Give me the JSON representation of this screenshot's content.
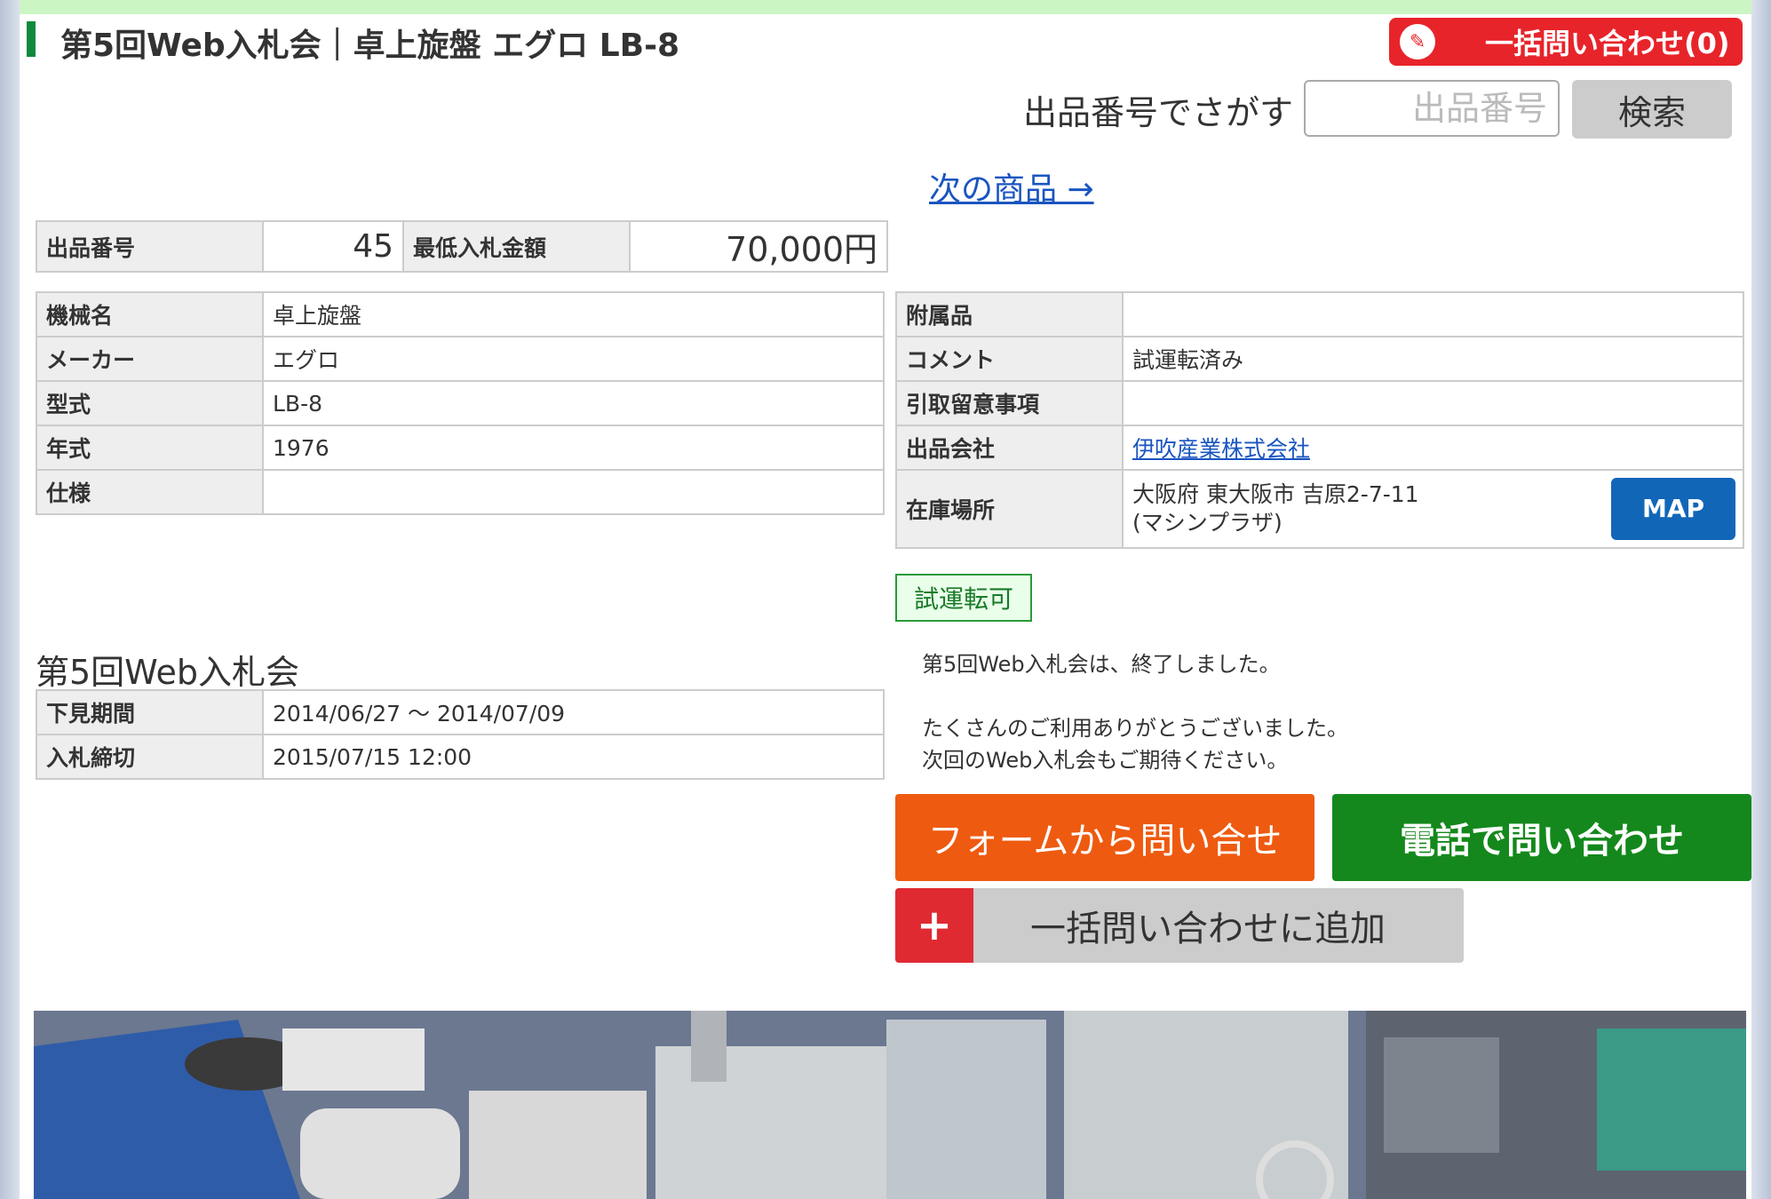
{
  "header": {
    "title": "第5回Web入札会｜卓上旋盤 エグロ LB-8",
    "bulk_inquiry_label": "一括問い合わせ(0)",
    "bulk_inquiry_icon": "clipboard-icon"
  },
  "search": {
    "label": "出品番号でさがす",
    "placeholder": "出品番号",
    "button": "検索"
  },
  "next_link": "次の商品 →",
  "summary": {
    "lot_label": "出品番号",
    "lot_value": "45",
    "min_bid_label": "最低入札金額",
    "min_bid_value": "70,000円"
  },
  "specs_left": [
    {
      "label": "機械名",
      "value": "卓上旋盤"
    },
    {
      "label": "メーカー",
      "value": "エグロ"
    },
    {
      "label": "型式",
      "value": "LB-8"
    },
    {
      "label": "年式",
      "value": "1976"
    },
    {
      "label": "仕様",
      "value": ""
    }
  ],
  "specs_right": [
    {
      "label": "附属品",
      "value": ""
    },
    {
      "label": "コメント",
      "value": "試運転済み"
    },
    {
      "label": "引取留意事項",
      "value": ""
    },
    {
      "label": "出品会社",
      "value": "伊吹産業株式会社"
    },
    {
      "label": "在庫場所",
      "value_line1": "大阪府 東大阪市 吉原2-7-11",
      "value_line2": "(マシンプラザ)",
      "map_button": "MAP"
    }
  ],
  "badge": "試運転可",
  "auction": {
    "title": "第5回Web入札会",
    "preview_label": "下見期間",
    "preview_value": "2014/06/27 〜 2014/07/09",
    "deadline_label": "入札締切",
    "deadline_value": "2015/07/15 12:00"
  },
  "notice": {
    "line1": "第5回Web入札会は、終了しました。",
    "line2": "たくさんのご利用ありがとうございました。",
    "line3": "次回のWeb入札会もご期待ください。"
  },
  "actions": {
    "form_inquiry": "フォームから問い合せ",
    "tel_inquiry": "電話で問い合わせ",
    "add_bulk": "一括問い合わせに追加",
    "add_icon": "plus-icon"
  },
  "colors": {
    "accent_red": "#e8242b",
    "accent_orange": "#ee5a10",
    "accent_green": "#14881c",
    "link_blue": "#1a55c0",
    "map_blue": "#1266b8"
  }
}
